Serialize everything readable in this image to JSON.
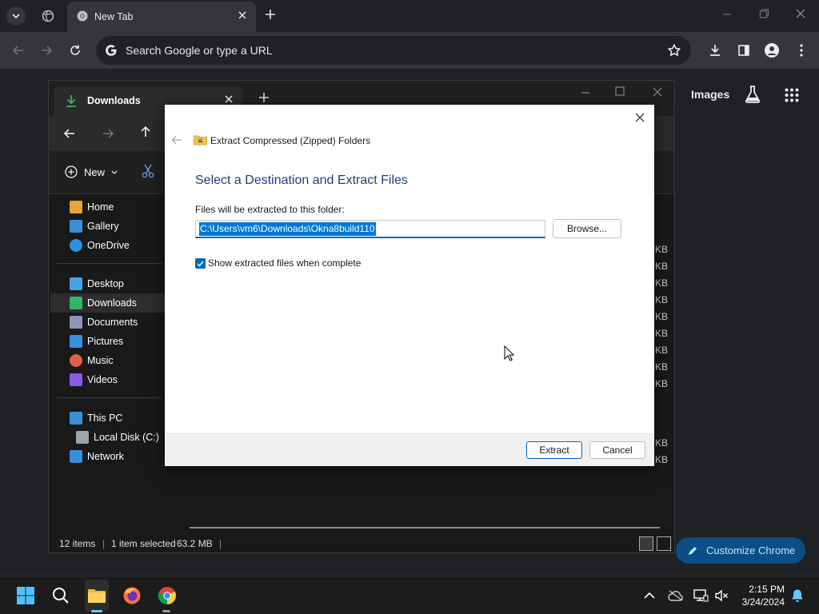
{
  "chrome": {
    "tab_title": "New Tab",
    "omnibox_placeholder": "Search Google or type a URL",
    "ntp_images_link": "Images",
    "customize_button": "Customize Chrome"
  },
  "explorer": {
    "tab_title": "Downloads",
    "new_button": "New",
    "nav": [
      {
        "label": "Home",
        "color": "#e8a33d"
      },
      {
        "label": "Gallery",
        "color": "#3b8fd9"
      },
      {
        "label": "OneDrive",
        "color": "#2d8fe0"
      },
      {
        "label": "Desktop",
        "color": "#4aa0e6"
      },
      {
        "label": "Downloads",
        "color": "#35b36b"
      },
      {
        "label": "Documents",
        "color": "#8a98b5"
      },
      {
        "label": "Pictures",
        "color": "#3b8fd9"
      },
      {
        "label": "Music",
        "color": "#e0614a"
      },
      {
        "label": "Videos",
        "color": "#8a5be6"
      },
      {
        "label": "This PC",
        "color": "#3b8fd9"
      },
      {
        "label": "Local Disk (C:)",
        "color": "#9aa4ad"
      },
      {
        "label": "Network",
        "color": "#3b8fd9"
      }
    ],
    "size_suffix": "KB",
    "status": {
      "items": "12 items",
      "selected": "1 item selected",
      "size": "63.2 MB"
    }
  },
  "dialog": {
    "window_title": "Extract Compressed (Zipped) Folders",
    "heading": "Select a Destination and Extract Files",
    "folder_label": "Files will be extracted to this folder:",
    "folder_path": "C:\\Users\\vm6\\Downloads\\Okna8build110",
    "browse_button": "Browse...",
    "show_files_checkbox": "Show extracted files when complete",
    "show_files_checked": true,
    "extract_button": "Extract",
    "cancel_button": "Cancel"
  },
  "taskbar": {
    "time": "2:15 PM",
    "date": "3/24/2024"
  }
}
